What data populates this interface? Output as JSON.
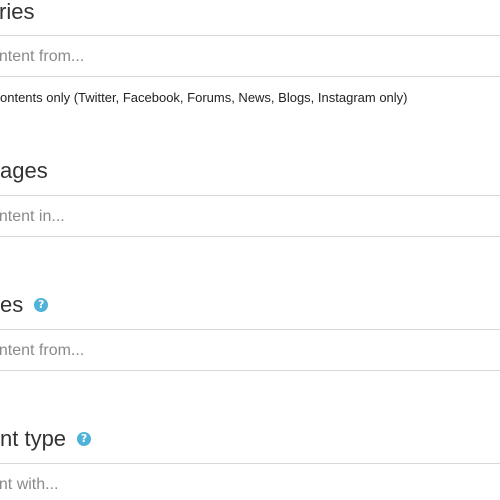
{
  "sections": [
    {
      "heading": "ries",
      "placeholder": "ontent from..."
    },
    {
      "heading": "ages",
      "placeholder": "ontent in..."
    },
    {
      "heading": "es",
      "placeholder": "ontent from...",
      "help_icon": "question-circle-icon",
      "help_glyph": "?"
    },
    {
      "heading": "nt type",
      "placeholder": "ent with...",
      "help_icon": "question-circle-icon",
      "help_glyph": "?"
    }
  ],
  "options": {
    "social_only_label": "ontents only (Twitter, Facebook, Forums, News, Blogs, Instagram only)"
  },
  "colors": {
    "help_icon": "#4fb3d9",
    "border": "#d8d8d8",
    "placeholder": "#8a8a8a"
  }
}
